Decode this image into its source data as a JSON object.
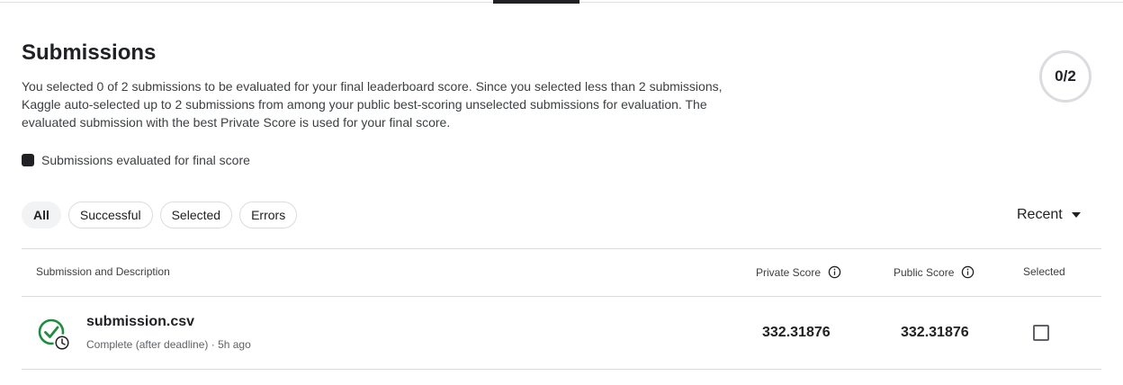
{
  "page": {
    "title": "Submissions",
    "description_lines": [
      "You selected 0 of 2 submissions to be evaluated for your final leaderboard score. Since you selected less than 2 submissions,",
      "Kaggle auto-selected up to 2 submissions from among your public best-scoring unselected submissions for evaluation. The",
      "evaluated submission with the best Private Score is used for your final score."
    ],
    "counter": "0/2"
  },
  "legend": {
    "label": "Submissions evaluated for final score"
  },
  "filters": [
    "All",
    "Successful",
    "Selected",
    "Errors"
  ],
  "active_filter": "All",
  "sort": {
    "label": "Recent"
  },
  "table": {
    "headers": {
      "submission": "Submission and Description",
      "private": "Private Score",
      "public": "Public Score",
      "selected": "Selected"
    },
    "rows": [
      {
        "file": "submission.csv",
        "status": "Complete (after deadline) · 5h ago",
        "private_score": "332.31876",
        "public_score": "332.31876",
        "selected": false,
        "status_icon": "check-circle-clock-icon"
      }
    ]
  },
  "colors": {
    "success_green": "#1e8e3e",
    "text_primary": "#202124",
    "divider": "#dadce0"
  }
}
